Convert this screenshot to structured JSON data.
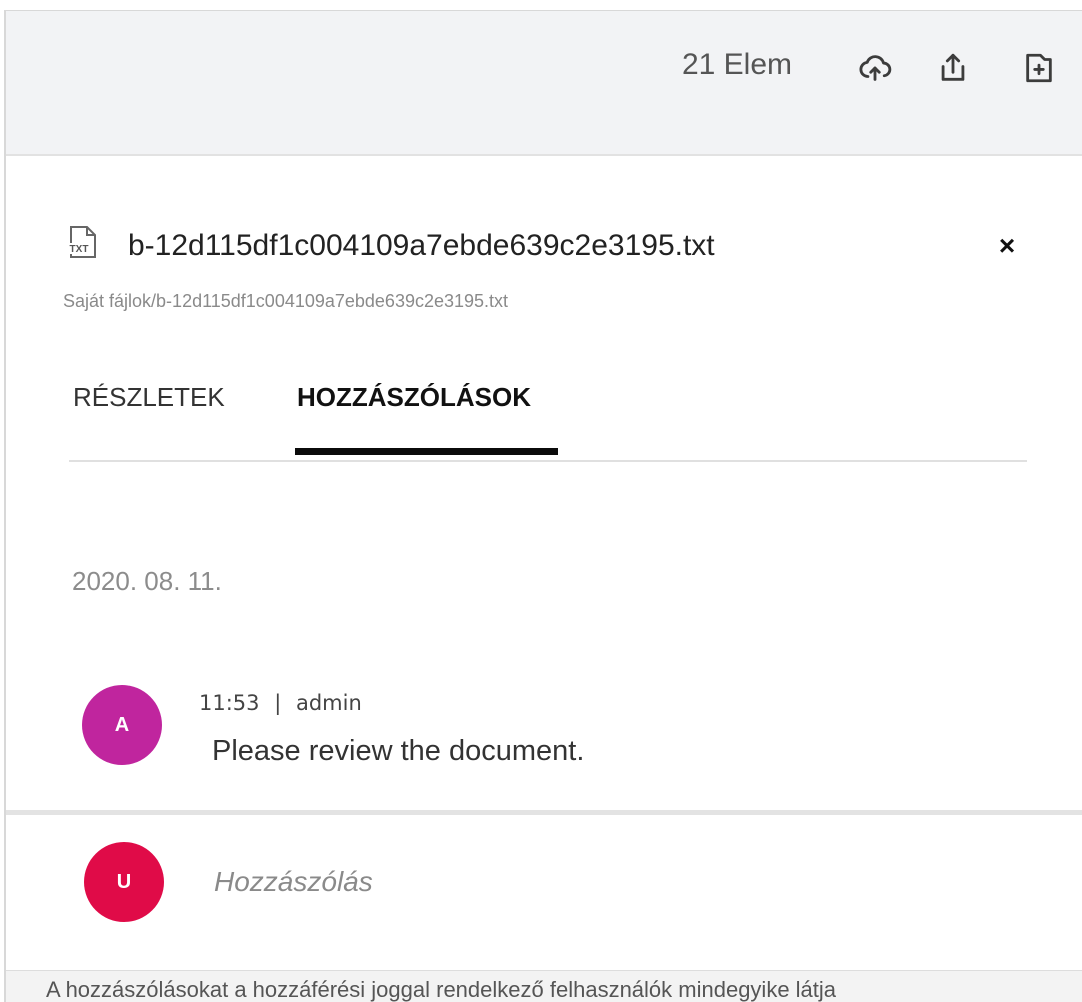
{
  "toolbar": {
    "item_count": "21 Elem",
    "icons": [
      "cloud-upload-icon",
      "share-export-icon",
      "new-folder-icon"
    ]
  },
  "file": {
    "type_label": "TXT",
    "name": "b-12d115df1c004109a7ebde639c2e3195.txt",
    "path": "Saját fájlok/b-12d115df1c004109a7ebde639c2e3195.txt",
    "close_symbol": "×"
  },
  "tabs": [
    {
      "label": "RÉSZLETEK",
      "active": false
    },
    {
      "label": "HOZZÁSZÓLÁSOK",
      "active": true
    }
  ],
  "comments": {
    "date": "2020. 08. 11.",
    "items": [
      {
        "avatar_letter": "A",
        "avatar_color": "#c0259e",
        "time": "11:53",
        "separator": "|",
        "author": "admin",
        "text": "Please review the document."
      }
    ]
  },
  "new_comment": {
    "avatar_letter": "U",
    "avatar_color": "#e00b48",
    "placeholder": "Hozzászólás"
  },
  "footer": {
    "note": "A hozzászólásokat a hozzáférési joggal rendelkező felhasználók mindegyike látja"
  }
}
